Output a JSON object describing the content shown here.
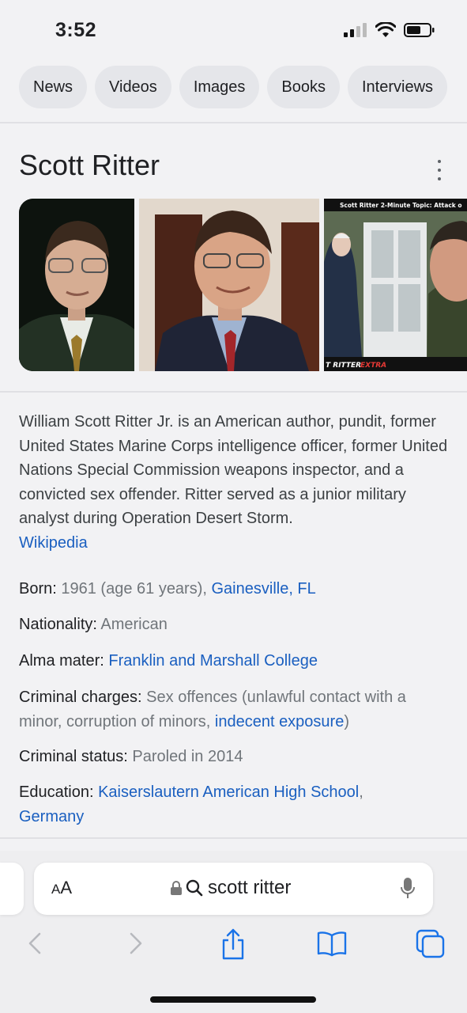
{
  "status_bar": {
    "time": "3:52"
  },
  "chips": [
    "News",
    "Videos",
    "Images",
    "Books",
    "Interviews"
  ],
  "panel": {
    "title": "Scott Ritter",
    "image3_caption": "Scott Ritter 2-Minute Topic: Attack o",
    "image3_logo_a": "T RITTER",
    "image3_logo_b": "EXTRA",
    "description": "William Scott Ritter Jr. is an American author, pundit, former United States Marine Corps intelligence officer, former United Nations Special Commission weapons inspector, and a convicted sex offender. Ritter served as a junior military analyst during Operation Desert Storm.",
    "source_link": "Wikipedia"
  },
  "facts": {
    "born_label": "Born:",
    "born_value": "1961 (age 61 years),",
    "born_link": "Gainesville, FL",
    "nationality_label": "Nationality:",
    "nationality_value": "American",
    "alma_label": "Alma mater:",
    "alma_link": "Franklin and Marshall College",
    "charges_label": "Criminal charges:",
    "charges_value": "Sex offences (unlawful contact with a minor, corruption of minors,",
    "charges_link": "indecent exposure",
    "charges_end": ")",
    "status_label": "Criminal status:",
    "status_value": "Paroled in 2014",
    "education_label": "Education:",
    "education_link1": "Kaiserslautern American High School",
    "education_sep": ",",
    "education_link2": "Germany"
  },
  "browser": {
    "text_size_small": "A",
    "text_size_large": "A",
    "url": "scott ritter"
  },
  "colors": {
    "link": "#1a5fc0",
    "accent": "#1a73e8"
  }
}
